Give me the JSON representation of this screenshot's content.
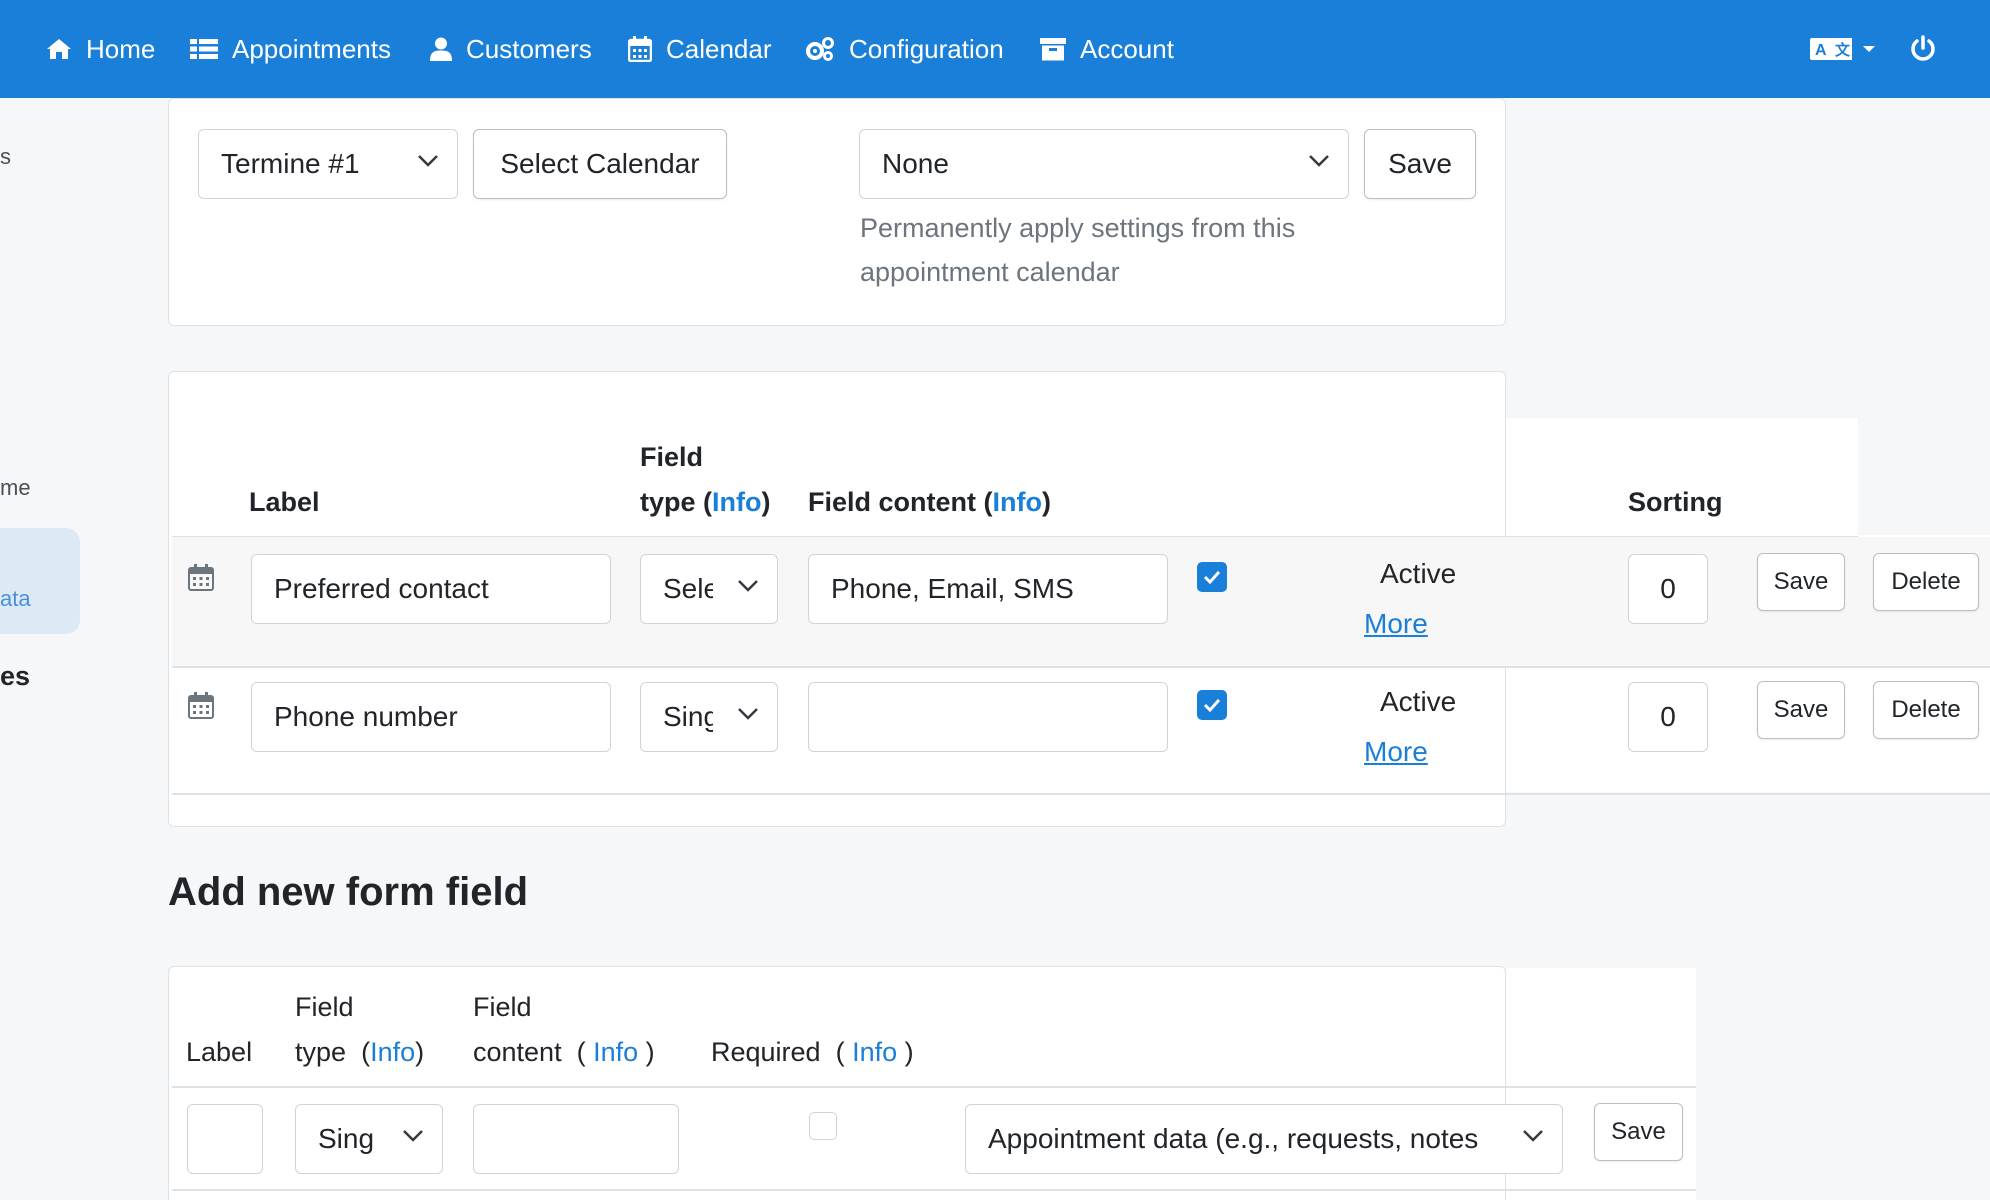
{
  "nav": {
    "items": [
      {
        "label": "Home",
        "icon": "home-icon"
      },
      {
        "label": "Appointments",
        "icon": "list-icon"
      },
      {
        "label": "Customers",
        "icon": "user-icon"
      },
      {
        "label": "Calendar",
        "icon": "calendar-icon"
      },
      {
        "label": "Configuration",
        "icon": "cogs-icon"
      },
      {
        "label": "Account",
        "icon": "archive-icon"
      }
    ],
    "language_icon": "language-icon",
    "power_icon": "power-icon"
  },
  "sidebar": {
    "fragments": [
      "s",
      "me",
      "ata",
      "es"
    ]
  },
  "calendar_selector": {
    "calendar_value": "Termine #1",
    "select_calendar_label": "Select Calendar",
    "template_value": "None",
    "save_label": "Save",
    "help_text": "Permanently apply settings from this appointment calendar"
  },
  "fields_table": {
    "headers": {
      "label": "Label",
      "field_type_line1": "Field",
      "field_type_line2": "type (",
      "field_content": "Field content (",
      "info": "Info",
      "close_paren": ")",
      "sorting": "Sorting"
    },
    "rows": [
      {
        "label": "Preferred contact",
        "field_type": "Sele",
        "content": "Phone, Email, SMS",
        "active": "Active",
        "more": "More",
        "sorting": "0",
        "save": "Save",
        "delete": "Delete"
      },
      {
        "label": "Phone number",
        "field_type": "Sing",
        "content": "",
        "active": "Active",
        "more": "More",
        "sorting": "0",
        "save": "Save",
        "delete": "Delete"
      }
    ]
  },
  "add_field": {
    "title": "Add new form field",
    "headers": {
      "label": "Label",
      "field": "Field",
      "type": "type",
      "content": "content",
      "required": "Required",
      "info": "Info",
      "open_paren_a": "(",
      "close_paren_a": ")",
      "open_paren_b": "(",
      "close_paren_b": ")",
      "open_paren_c": "(",
      "close_paren_c": ")"
    },
    "field_type_value": "Sing",
    "category_value": "Appointment data (e.g., requests, notes",
    "save_label": "Save"
  },
  "colors": {
    "primary": "#1a7fd8",
    "nav_bg": "#1a7fd8",
    "page_bg": "#f6f7f9"
  }
}
